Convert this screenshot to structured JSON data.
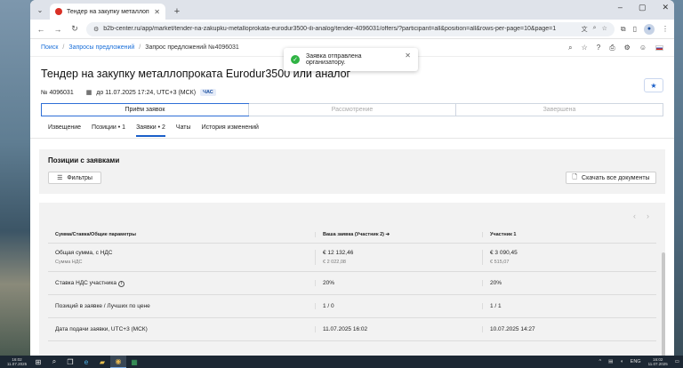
{
  "browser": {
    "tab_title": "Тендер на закупку металлопрока",
    "url": "b2b-center.ru/app/market/tender-na-zakupku-metalloprokata-eurodur3500-ili-analog/tender-4096031/offers/?participant=all&position=all&rows-per-page=10&page=1"
  },
  "breadcrumb": {
    "items": [
      "Поиск",
      "Запросы предложений",
      "Запрос предложений №4096031"
    ],
    "separator": "/"
  },
  "toast": {
    "text": "Заявка отправлена организатору."
  },
  "page": {
    "title": "Тендер на закупку металлопроката Eurodur3500 или аналог",
    "number": "№ 4096031",
    "deadline": "до 11.07.2025 17:24, UTC+3 (МСК)",
    "tz_badge": "ЧАС"
  },
  "stages": [
    "Приём заявок",
    "Рассмотрение",
    "Завершена"
  ],
  "tabs": [
    "Извещение",
    "Позиции • 1",
    "Заявки • 2",
    "Чаты",
    "История изменений"
  ],
  "positions": {
    "title": "Позиции с заявками",
    "filter_label": "Фильтры",
    "download_label": "Скачать все документы"
  },
  "table": {
    "headers": [
      "Сумма/Ставка/Общие параметры",
      "Ваша заявка (Участник 2)",
      "Участник 1"
    ],
    "rows": [
      {
        "label": "Общая сумма, с НДС",
        "sublabel": "Сумма НДС",
        "v1": "€ 12 132,46",
        "v1sub": "€ 2 022,08",
        "v2": "€ 3 090,45",
        "v2sub": "€ 515,07"
      },
      {
        "label": "Ставка НДС участника",
        "v1": "20%",
        "v2": "20%"
      },
      {
        "label": "Позиций в заявке / Лучших по цене",
        "v1": "1 / 0",
        "v2": "1 / 1"
      },
      {
        "label": "Дата подачи заявки, UTC+3 (МСК)",
        "v1": "11.07.2025 16:02",
        "v2": "10.07.2025 14:27"
      }
    ]
  },
  "taskbar": {
    "left_time": "16:02",
    "left_date": "11.07.2025",
    "lang": "ENG",
    "time": "16:02",
    "date": "11.07.2025"
  }
}
